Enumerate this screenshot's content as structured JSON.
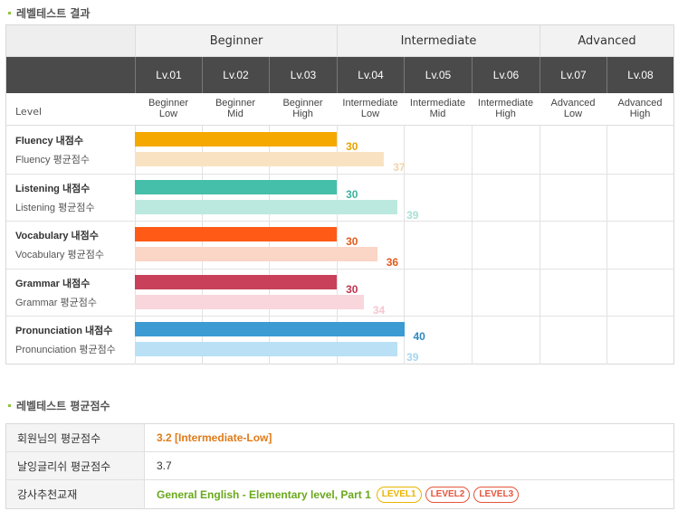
{
  "section1": {
    "title": "레벨테스트 결과"
  },
  "section2": {
    "title": "레벨테스트 평균점수"
  },
  "groups": [
    "Beginner",
    "Intermediate",
    "Advanced"
  ],
  "levels": [
    "Lv.01",
    "Lv.02",
    "Lv.03",
    "Lv.04",
    "Lv.05",
    "Lv.06",
    "Lv.07",
    "Lv.08"
  ],
  "level_row_label": "Level",
  "level_names": [
    [
      "Beginner",
      "Low"
    ],
    [
      "Beginner",
      "Mid"
    ],
    [
      "Beginner",
      "High"
    ],
    [
      "Intermediate",
      "Low"
    ],
    [
      "Intermediate",
      "Mid"
    ],
    [
      "Intermediate",
      "High"
    ],
    [
      "Advanced",
      "Low"
    ],
    [
      "Advanced",
      "High"
    ]
  ],
  "chart_data": {
    "type": "bar",
    "categories": [
      "Fluency",
      "Listening",
      "Vocabulary",
      "Grammar",
      "Pronunciation"
    ],
    "series": [
      {
        "name": "내점수",
        "values": [
          30,
          30,
          30,
          30,
          40
        ]
      },
      {
        "name": "평균점수",
        "values": [
          37,
          39,
          36,
          34,
          39
        ]
      }
    ],
    "ylim": [
      0,
      80
    ],
    "rows": [
      {
        "name": "Fluency 내점수",
        "avg_label": "Fluency 평균점수",
        "mine": 30,
        "mine_label": "30",
        "avg": 37,
        "avg_label_val": "37",
        "color": "#f5a800",
        "avg_color": "#f9e2c2",
        "mine_text": "#e8a200",
        "avg_text": "#f3d3a8"
      },
      {
        "name": "Listening 내점수",
        "avg_label": "Listening 평균점수",
        "mine": 30,
        "mine_label": "30",
        "avg": 39,
        "avg_label_val": "39",
        "color": "#45bfa9",
        "avg_color": "#bce9df",
        "mine_text": "#3db39d",
        "avg_text": "#a9e0d4"
      },
      {
        "name": "Vocabulary 내점수",
        "avg_label": "Vocabulary 평균점수",
        "mine": 30,
        "mine_label": "30",
        "avg": 36,
        "avg_label_val": "36",
        "color": "#ff5a16",
        "avg_color": "#fbd5c6",
        "mine_text": "#e35a1a",
        "avg_text": "#e35a1a"
      },
      {
        "name": "Grammar 내점수",
        "avg_label": "Grammar 평균점수",
        "mine": 30,
        "mine_label": "30",
        "avg": 34,
        "avg_label_val": "34",
        "color": "#c8405a",
        "avg_color": "#f8d6dc",
        "mine_text": "#c0344f",
        "avg_text": "#f5c6cf"
      },
      {
        "name": "Pronunciation 내점수",
        "avg_label": "Pronunciation 평균점수",
        "mine": 40,
        "mine_label": "40",
        "avg": 39,
        "avg_label_val": "39",
        "color": "#3d9bd3",
        "avg_color": "#b9e0f5",
        "mine_text": "#2f88c0",
        "avg_text": "#a8d5ef"
      }
    ]
  },
  "summary": {
    "rows": [
      {
        "label": "회원님의 평균점수",
        "value": "3.2 [Intermediate-Low]",
        "color": "#e07b1a"
      },
      {
        "label": "날잉글리쉬 평균점수",
        "value": "3.7",
        "color": "#333333"
      },
      {
        "label": "강사추천교재",
        "value": "General English - Elementary level, Part 1",
        "color": "#6aa81b"
      }
    ],
    "badges": [
      {
        "label": "LEVEL1",
        "color": "#e8b400"
      },
      {
        "label": "LEVEL2",
        "color": "#e5553d"
      },
      {
        "label": "LEVEL3",
        "color": "#e5553d"
      }
    ]
  }
}
